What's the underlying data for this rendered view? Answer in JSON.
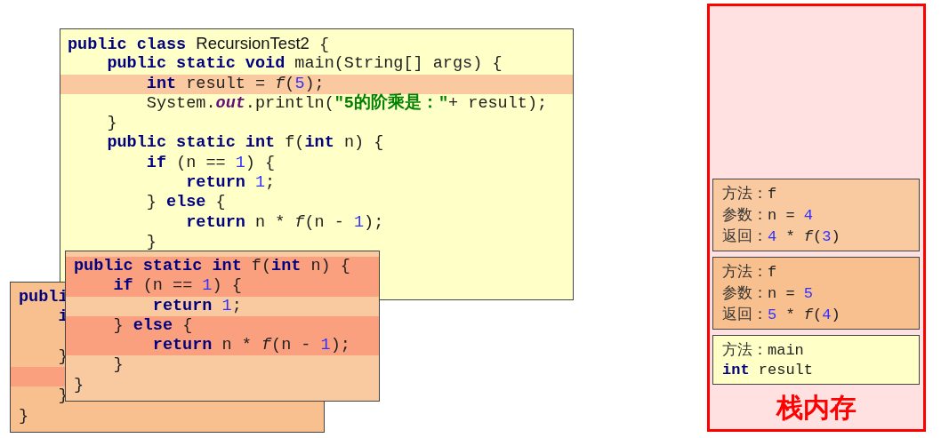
{
  "code_panels": [
    {
      "color": "#ffffc8",
      "lines": [
        {
          "highlighted": false,
          "tokens": [
            {
              "kind": "kw",
              "text": "public class "
            },
            {
              "kind": "sans",
              "text": "RecursionTest2"
            },
            {
              "kind": "plain",
              "text": " {"
            }
          ]
        },
        {
          "highlighted": false,
          "tokens": [
            {
              "kind": "kw",
              "text": "    public static void "
            },
            {
              "kind": "plain",
              "text": "main(String[] args) {"
            }
          ]
        },
        {
          "highlighted": true,
          "color": "#fbc9a0",
          "tokens": [
            {
              "kind": "kw",
              "text": "        int"
            },
            {
              "kind": "plain",
              "text": " result = "
            },
            {
              "kind": "fn",
              "text": "f"
            },
            {
              "kind": "plain",
              "text": "("
            },
            {
              "kind": "num",
              "text": "5"
            },
            {
              "kind": "plain",
              "text": ");"
            }
          ]
        },
        {
          "highlighted": false,
          "tokens": [
            {
              "kind": "plain",
              "text": "        System."
            },
            {
              "kind": "field",
              "text": "out"
            },
            {
              "kind": "plain",
              "text": ".println("
            },
            {
              "kind": "str",
              "text": "\"5的阶乘是：\""
            },
            {
              "kind": "plain",
              "text": "+ result);"
            }
          ]
        },
        {
          "highlighted": false,
          "tokens": [
            {
              "kind": "plain",
              "text": "    }"
            }
          ]
        },
        {
          "highlighted": false,
          "tokens": [
            {
              "kind": "kw",
              "text": "    public static int "
            },
            {
              "kind": "plain",
              "text": "f("
            },
            {
              "kind": "kw",
              "text": "int"
            },
            {
              "kind": "plain",
              "text": " n) {"
            }
          ]
        },
        {
          "highlighted": false,
          "tokens": [
            {
              "kind": "kw",
              "text": "        if"
            },
            {
              "kind": "plain",
              "text": " (n == "
            },
            {
              "kind": "num",
              "text": "1"
            },
            {
              "kind": "plain",
              "text": ") {"
            }
          ]
        },
        {
          "highlighted": false,
          "tokens": [
            {
              "kind": "kw",
              "text": "            return "
            },
            {
              "kind": "num",
              "text": "1"
            },
            {
              "kind": "plain",
              "text": ";"
            }
          ]
        },
        {
          "highlighted": false,
          "tokens": [
            {
              "kind": "plain",
              "text": "        } "
            },
            {
              "kind": "kw",
              "text": "else"
            },
            {
              "kind": "plain",
              "text": " {"
            }
          ]
        },
        {
          "highlighted": false,
          "tokens": [
            {
              "kind": "kw",
              "text": "            return"
            },
            {
              "kind": "plain",
              "text": " n * "
            },
            {
              "kind": "fn",
              "text": "f"
            },
            {
              "kind": "plain",
              "text": "(n - "
            },
            {
              "kind": "num",
              "text": "1"
            },
            {
              "kind": "plain",
              "text": ");"
            }
          ]
        },
        {
          "highlighted": false,
          "tokens": [
            {
              "kind": "plain",
              "text": "        }"
            }
          ]
        }
      ]
    },
    {
      "color": "#f8c08e",
      "lines": [
        {
          "highlighted": false,
          "tokens": [
            {
              "kind": "kw",
              "text": "publi"
            }
          ]
        },
        {
          "highlighted": false,
          "tokens": [
            {
              "kind": "kw",
              "text": "    i"
            }
          ]
        },
        {
          "highlighted": false
        },
        {
          "highlighted": false,
          "tokens": [
            {
              "kind": "plain",
              "text": "    }"
            }
          ]
        },
        {
          "highlighted": true,
          "color": "#fba07f"
        },
        {
          "highlighted": false,
          "tokens": [
            {
              "kind": "plain",
              "text": "    }"
            }
          ]
        },
        {
          "highlighted": false,
          "tokens": [
            {
              "kind": "plain",
              "text": "}"
            }
          ]
        }
      ]
    },
    {
      "color": "#f9c9a0",
      "lines": [
        {
          "highlighted": true,
          "color": "#fba07f",
          "tokens": [
            {
              "kind": "kw",
              "text": "public static int "
            },
            {
              "kind": "plain",
              "text": "f("
            },
            {
              "kind": "kw",
              "text": "int"
            },
            {
              "kind": "plain",
              "text": " n) {"
            }
          ]
        },
        {
          "highlighted": true,
          "color": "#fba07f",
          "tokens": [
            {
              "kind": "kw",
              "text": "    if"
            },
            {
              "kind": "plain",
              "text": " (n == "
            },
            {
              "kind": "num",
              "text": "1"
            },
            {
              "kind": "plain",
              "text": ") {"
            }
          ]
        },
        {
          "highlighted": false,
          "tokens": [
            {
              "kind": "kw",
              "text": "        return "
            },
            {
              "kind": "num",
              "text": "1"
            },
            {
              "kind": "plain",
              "text": ";"
            }
          ]
        },
        {
          "highlighted": true,
          "color": "#fba07f",
          "tokens": [
            {
              "kind": "plain",
              "text": "    } "
            },
            {
              "kind": "kw",
              "text": "else"
            },
            {
              "kind": "plain",
              "text": " {"
            }
          ]
        },
        {
          "highlighted": true,
          "color": "#fba07f",
          "tokens": [
            {
              "kind": "kw",
              "text": "        return"
            },
            {
              "kind": "plain",
              "text": " n * "
            },
            {
              "kind": "fn",
              "text": "f"
            },
            {
              "kind": "plain",
              "text": "(n - "
            },
            {
              "kind": "num",
              "text": "1"
            },
            {
              "kind": "plain",
              "text": ");"
            }
          ]
        },
        {
          "highlighted": false,
          "tokens": [
            {
              "kind": "plain",
              "text": "    }"
            }
          ]
        },
        {
          "highlighted": false,
          "tokens": [
            {
              "kind": "plain",
              "text": "}"
            }
          ]
        }
      ]
    }
  ],
  "stack": {
    "title": "栈内存",
    "frames": [
      {
        "color": "#f9c9a0",
        "lines": [
          [
            {
              "kind": "label",
              "text": "方法："
            },
            {
              "kind": "plain",
              "text": "f"
            }
          ],
          [
            {
              "kind": "label",
              "text": "参数："
            },
            {
              "kind": "plain",
              "text": "n = "
            },
            {
              "kind": "num",
              "text": "4"
            }
          ],
          [
            {
              "kind": "label",
              "text": "返回："
            },
            {
              "kind": "num",
              "text": "4"
            },
            {
              "kind": "plain",
              "text": " * "
            },
            {
              "kind": "fn",
              "text": "f"
            },
            {
              "kind": "plain",
              "text": "("
            },
            {
              "kind": "num",
              "text": "3"
            },
            {
              "kind": "plain",
              "text": ")"
            }
          ]
        ]
      },
      {
        "color": "#f8c08e",
        "lines": [
          [
            {
              "kind": "label",
              "text": "方法："
            },
            {
              "kind": "plain",
              "text": "f"
            }
          ],
          [
            {
              "kind": "label",
              "text": "参数："
            },
            {
              "kind": "plain",
              "text": "n = "
            },
            {
              "kind": "num",
              "text": "5"
            }
          ],
          [
            {
              "kind": "label",
              "text": "返回："
            },
            {
              "kind": "num",
              "text": "5"
            },
            {
              "kind": "plain",
              "text": " * "
            },
            {
              "kind": "fn",
              "text": "f"
            },
            {
              "kind": "plain",
              "text": "("
            },
            {
              "kind": "num",
              "text": "4"
            },
            {
              "kind": "plain",
              "text": ")"
            }
          ]
        ]
      },
      {
        "color": "#ffffc8",
        "lines": [
          [
            {
              "kind": "label",
              "text": "方法："
            },
            {
              "kind": "plain",
              "text": "main"
            }
          ],
          [
            {
              "kind": "kw",
              "text": "int"
            },
            {
              "kind": "plain",
              "text": " result"
            }
          ]
        ]
      }
    ]
  }
}
